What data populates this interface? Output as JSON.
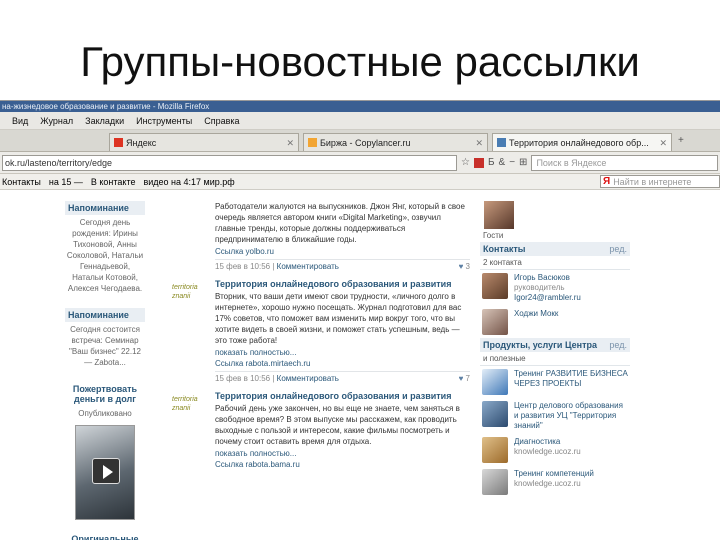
{
  "slide_title": "Группы-новостные рассылки",
  "browser": {
    "window_title": "на-жизнедовое образование и развитие - Mozilla Firefox",
    "menu": [
      "Вид",
      "Журнал",
      "Закладки",
      "Инструменты",
      "Справка"
    ],
    "tabs": [
      {
        "label": "Яндекс",
        "active": false
      },
      {
        "label": "Биржа - Copylancer.ru",
        "active": false
      },
      {
        "label": "Территория онлайнедового обр...",
        "active": true
      }
    ],
    "url": "ok.ru/lasteno/territory/edge",
    "search_placeholder": "Поиск в Яндексе",
    "search2_placeholder": "Найти в интернете",
    "bookmarks": [
      "Контакты",
      "на 15 —",
      "В контакте",
      "видео на 4:17 мир.рф"
    ]
  },
  "left": {
    "reminder_title": "Напоминание",
    "reminder_text": "Сегодня день рождения: Ирины Тихоновой, Анны Соколовой, Натальи Геннадьевой, Натальи Котовой, Алексея Чегодаева.",
    "reminder2_title": "Напоминание",
    "reminder2_text": "Сегодня состоится встреча: Семинар \"Ваш бизнес\" 22.12 — Zabota...",
    "donate_title": "Пожертвовать деньги в долг",
    "donate_sub": "Опубликовано",
    "originals_title": "Оригинальные"
  },
  "posts": [
    {
      "title": "",
      "text": "Работодатели жалуются на выпускников. Джон Янг, который в свое очередь является автором книги «Digital Marketing», озвучил главные тренды, которые должны поддерживаться предпринимателю в ближайшие годы.",
      "link": "Ссылка yolbo.ru",
      "date": "15 фев в 10:56",
      "comment": "Комментировать",
      "likes": "3"
    },
    {
      "title": "Территория онлайнедового образования и развития",
      "text": "Вторник, что ваши дети имеют свои трудности, «личного долго в интернете», хорошо нужно посещать. Журнал подготовил для вас 17% советов, что поможет вам изменить мир вокруг того, что вы хотите видеть в своей жизни, и поможет стать успешным, ведь — это тоже работа!",
      "more": "показать полностью...",
      "link": "Ссылка rabota.mirtaech.ru",
      "date": "15 фев в 10:56",
      "comment": "Комментировать",
      "likes": "7"
    },
    {
      "title": "Территория онлайнедового образования и развития",
      "text": "Рабочий день уже закончен, но вы еще не знаете, чем заняться в свободное время? В этом выпуске мы расскажем, как проводить выходные с пользой и интересом, какие фильмы посмотреть и почему стоит оставить время для отдыха.",
      "more": "показать полностью...",
      "link": "Ссылка rabota.bama.ru",
      "date": "",
      "comment": "",
      "likes": ""
    }
  ],
  "right": {
    "owner_label": "Гости",
    "contacts_title": "Контакты",
    "edit_label": "ред.",
    "contacts_count": "2 контакта",
    "contacts": [
      {
        "name": "Игорь Васюков",
        "role": "руководитель",
        "email": "Igor24@rambler.ru"
      },
      {
        "name": "Ходжи Мокк",
        "role": "",
        "email": ""
      }
    ],
    "products_title": "Продукты, услуги Центра",
    "products_sub": "и полезные",
    "products": [
      {
        "name": "Тренинг РАЗВИТИЕ БИЗНЕСА ЧЕРЕЗ ПРОЕКТЫ",
        "sub": ""
      },
      {
        "name": "Центр делового образования и развития УЦ \"Территория знаний\"",
        "sub": ""
      },
      {
        "name": "Диагностика",
        "sub": "knowledge.ucoz.ru"
      },
      {
        "name": "Тренинг компетенций",
        "sub": "knowledge.ucoz.ru"
      }
    ]
  }
}
